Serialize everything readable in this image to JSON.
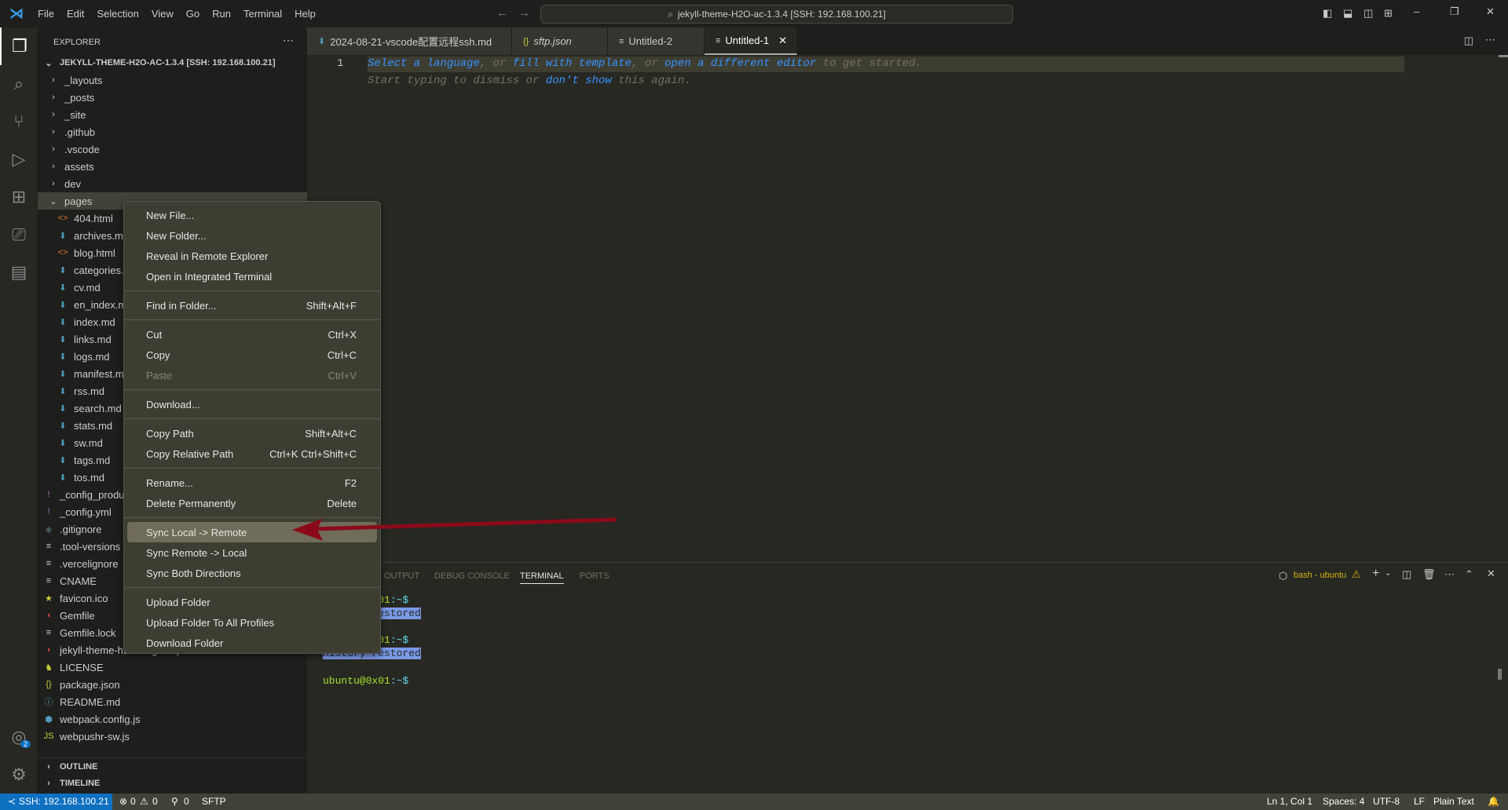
{
  "titlebar": {
    "menus": [
      "File",
      "Edit",
      "Selection",
      "View",
      "Go",
      "Run",
      "Terminal",
      "Help"
    ],
    "search": "jekyll-theme-H2O-ac-1.3.4 [SSH: 192.168.100.21]"
  },
  "sidebar": {
    "title": "EXPLORER",
    "root": "JEKYLL-THEME-H2O-AC-1.3.4 [SSH: 192.168.100.21]",
    "folders": [
      "_layouts",
      "_posts",
      "_site",
      ".github",
      ".vscode",
      "assets",
      "dev"
    ],
    "open_folder": "pages",
    "pages_children": [
      {
        "name": "404.html",
        "icon": "html"
      },
      {
        "name": "archives.md",
        "icon": "md"
      },
      {
        "name": "blog.html",
        "icon": "html"
      },
      {
        "name": "categories.md",
        "icon": "md"
      },
      {
        "name": "cv.md",
        "icon": "md"
      },
      {
        "name": "en_index.md",
        "icon": "md"
      },
      {
        "name": "index.md",
        "icon": "md"
      },
      {
        "name": "links.md",
        "icon": "md"
      },
      {
        "name": "logs.md",
        "icon": "md"
      },
      {
        "name": "manifest.md",
        "icon": "md"
      },
      {
        "name": "rss.md",
        "icon": "md"
      },
      {
        "name": "search.md",
        "icon": "md"
      },
      {
        "name": "stats.md",
        "icon": "md"
      },
      {
        "name": "sw.md",
        "icon": "md"
      },
      {
        "name": "tags.md",
        "icon": "md"
      },
      {
        "name": "tos.md",
        "icon": "md"
      }
    ],
    "files": [
      {
        "name": "_config_production.yml",
        "icon": "yml"
      },
      {
        "name": "_config.yml",
        "icon": "yml"
      },
      {
        "name": ".gitignore",
        "icon": "git"
      },
      {
        "name": ".tool-versions",
        "icon": "text"
      },
      {
        "name": ".vercelignore",
        "icon": "text"
      },
      {
        "name": "CNAME",
        "icon": "text"
      },
      {
        "name": "favicon.ico",
        "icon": "star"
      },
      {
        "name": "Gemfile",
        "icon": "ruby"
      },
      {
        "name": "Gemfile.lock",
        "icon": "text"
      },
      {
        "name": "jekyll-theme-h2o-ac.gemspec",
        "icon": "ruby"
      },
      {
        "name": "LICENSE",
        "icon": "license"
      },
      {
        "name": "package.json",
        "icon": "json"
      },
      {
        "name": "README.md",
        "icon": "info"
      },
      {
        "name": "webpack.config.js",
        "icon": "webpack"
      },
      {
        "name": "webpushr-sw.js",
        "icon": "js"
      }
    ],
    "outline": "OUTLINE",
    "timeline": "TIMELINE"
  },
  "tabs": [
    {
      "label": "2024-08-21-vscode配置远程ssh.md",
      "icon": "md"
    },
    {
      "label": "sftp.json",
      "icon": "json"
    },
    {
      "label": "Untitled-2",
      "icon": "text"
    },
    {
      "label": "Untitled-1",
      "icon": "text",
      "active": true
    }
  ],
  "editor": {
    "line_number": "1",
    "hint1": [
      "Select a language",
      ", or ",
      "fill with template",
      ", or ",
      "open a different editor",
      " to get started."
    ],
    "hint2": [
      "Start typing to dismiss or ",
      "don't show",
      " this again."
    ]
  },
  "panel": {
    "tabs": [
      "OUTPUT",
      "DEBUG CONSOLE",
      "TERMINAL",
      "PORTS"
    ],
    "active": "TERMINAL",
    "terminal_name": "bash - ubuntu",
    "lines": [
      {
        "user": "ubuntu@0x01",
        "path": ":~$"
      },
      {
        "restored": "History restored"
      },
      {
        "user": "ubuntu@0x01",
        "path": ":~$"
      },
      {
        "restored": "History restored"
      },
      {
        "user": "ubuntu@0x01",
        "path": ":~$"
      }
    ]
  },
  "context_menu": [
    {
      "label": "New File..."
    },
    {
      "label": "New Folder..."
    },
    {
      "label": "Reveal in Remote Explorer"
    },
    {
      "label": "Open in Integrated Terminal"
    },
    {
      "sep": true
    },
    {
      "label": "Find in Folder...",
      "key": "Shift+Alt+F"
    },
    {
      "sep": true
    },
    {
      "label": "Cut",
      "key": "Ctrl+X"
    },
    {
      "label": "Copy",
      "key": "Ctrl+C"
    },
    {
      "label": "Paste",
      "key": "Ctrl+V",
      "disabled": true
    },
    {
      "sep": true
    },
    {
      "label": "Download..."
    },
    {
      "sep": true
    },
    {
      "label": "Copy Path",
      "key": "Shift+Alt+C"
    },
    {
      "label": "Copy Relative Path",
      "key": "Ctrl+K Ctrl+Shift+C"
    },
    {
      "sep": true
    },
    {
      "label": "Rename...",
      "key": "F2"
    },
    {
      "label": "Delete Permanently",
      "key": "Delete"
    },
    {
      "sep": true
    },
    {
      "label": "Sync Local -> Remote",
      "highlighted": true
    },
    {
      "label": "Sync Remote -> Local"
    },
    {
      "label": "Sync Both Directions"
    },
    {
      "sep": true
    },
    {
      "label": "Upload Folder"
    },
    {
      "label": "Upload Folder To All Profiles"
    },
    {
      "label": "Download Folder"
    }
  ],
  "statusbar": {
    "remote": "SSH: 192.168.100.21",
    "errors": "0",
    "warnings": "0",
    "ports": "0",
    "sftp": "SFTP",
    "position": "Ln 1, Col 1",
    "spaces": "Spaces: 4",
    "encoding": "UTF-8",
    "eol": "LF",
    "language": "Plain Text"
  },
  "account_badge": "2",
  "colors": {
    "accent": "#007acc",
    "annotation_arrow": "#8b0a1a",
    "status_bar": "#414339",
    "editor_bg": "#272822"
  }
}
